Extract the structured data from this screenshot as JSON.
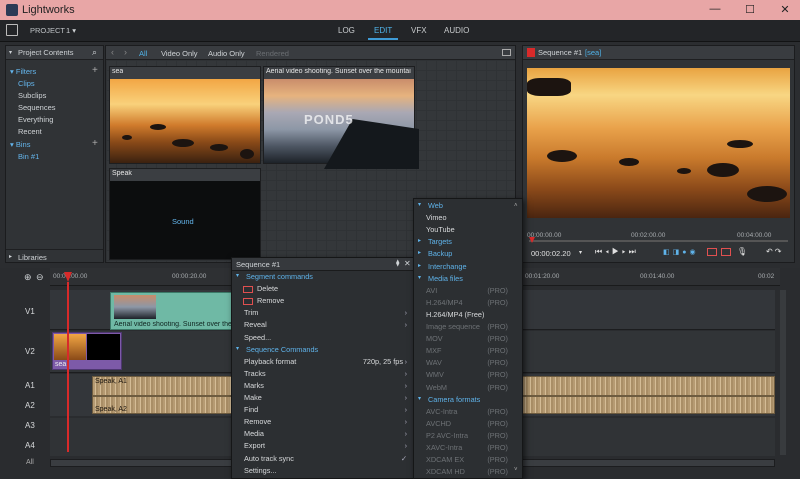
{
  "app": {
    "title": "Lightworks",
    "window": {
      "min": "—",
      "max": "☐",
      "close": "✕"
    }
  },
  "topbar": {
    "project_label": "PROJECT",
    "project_num": "1",
    "tabs": [
      "LOG",
      "EDIT",
      "VFX",
      "AUDIO"
    ],
    "active_tab": "EDIT"
  },
  "sidebar": {
    "title": "Project Contents",
    "filters_label": "Filters",
    "items": [
      "Clips",
      "Subclips",
      "Sequences",
      "Everything",
      "Recent"
    ],
    "bins_label": "Bins",
    "bin_items": [
      "Bin #1"
    ],
    "libraries": "Libraries"
  },
  "browser": {
    "filters": [
      "All",
      "Video Only",
      "Audio Only",
      "Rendered"
    ],
    "clips": [
      {
        "label": "sea",
        "bg": "sunset"
      },
      {
        "label": "Aerial video shooting. Sunset over the mountai",
        "bg": "aerial",
        "watermark": "POND5"
      },
      {
        "label": "Speak",
        "bg": "sound",
        "inner": "Sound"
      }
    ]
  },
  "viewer": {
    "title": "Sequence #1",
    "tag": "[sea]",
    "timecodes": [
      "00:00:00.00",
      "00:02:00.00",
      "00:04:00.00"
    ],
    "current": "00:00:02.20"
  },
  "timeline": {
    "ruler": [
      "00:00:00.00",
      "00:00:20.00",
      "00:01:20.00",
      "00:01:40.00",
      "00:02"
    ],
    "tracks": [
      "V1",
      "V2",
      "A1",
      "A2",
      "A3",
      "A4"
    ],
    "clips": {
      "v1": "Aerial video shooting. Sunset over the",
      "v2": "sea",
      "a1": "Speak, A1",
      "a2": "Speak, A2"
    },
    "all_label": "All"
  },
  "context_menu": {
    "title": "Sequence #1",
    "items": [
      {
        "t": "Segment commands",
        "k": "sec"
      },
      {
        "t": "Delete",
        "k": "icon"
      },
      {
        "t": "Remove",
        "k": "icon"
      },
      {
        "t": "Trim",
        "k": "sub"
      },
      {
        "t": "Reveal",
        "k": "sub"
      },
      {
        "t": "Speed...",
        "k": "item"
      },
      {
        "t": "Sequence Commands",
        "k": "sec"
      },
      {
        "t": "Playback format",
        "k": "item",
        "r": "720p, 25 fps"
      },
      {
        "t": "Tracks",
        "k": "sub"
      },
      {
        "t": "Marks",
        "k": "sub"
      },
      {
        "t": "Make",
        "k": "sub"
      },
      {
        "t": "Find",
        "k": "sub"
      },
      {
        "t": "Remove",
        "k": "sub"
      },
      {
        "t": "Media",
        "k": "sub"
      },
      {
        "t": "Export",
        "k": "sub"
      },
      {
        "t": "Auto track sync",
        "k": "check"
      },
      {
        "t": "Settings...",
        "k": "item"
      }
    ]
  },
  "export_menu": {
    "items": [
      {
        "t": "Web",
        "k": "sec"
      },
      {
        "t": "Vimeo",
        "k": "item"
      },
      {
        "t": "YouTube",
        "k": "item"
      },
      {
        "t": "Targets",
        "k": "sec"
      },
      {
        "t": "Backup",
        "k": "sec"
      },
      {
        "t": "Interchange",
        "k": "sec"
      },
      {
        "t": "Media files",
        "k": "sec"
      },
      {
        "t": "AVI",
        "k": "dis",
        "r": "(PRO)"
      },
      {
        "t": "H.264/MP4",
        "k": "dis",
        "r": "(PRO)"
      },
      {
        "t": "H.264/MP4 (Free)",
        "k": "item"
      },
      {
        "t": "Image sequence",
        "k": "dis",
        "r": "(PRO)"
      },
      {
        "t": "MOV",
        "k": "dis",
        "r": "(PRO)"
      },
      {
        "t": "MXF",
        "k": "dis",
        "r": "(PRO)"
      },
      {
        "t": "WAV",
        "k": "dis",
        "r": "(PRO)"
      },
      {
        "t": "WMV",
        "k": "dis",
        "r": "(PRO)"
      },
      {
        "t": "WebM",
        "k": "dis",
        "r": "(PRO)"
      },
      {
        "t": "Camera formats",
        "k": "sec"
      },
      {
        "t": "AVC-Intra",
        "k": "dis",
        "r": "(PRO)"
      },
      {
        "t": "AVCHD",
        "k": "dis",
        "r": "(PRO)"
      },
      {
        "t": "P2 AVC-Intra",
        "k": "dis",
        "r": "(PRO)"
      },
      {
        "t": "XAVC-Intra",
        "k": "dis",
        "r": "(PRO)"
      },
      {
        "t": "XDCAM EX",
        "k": "dis",
        "r": "(PRO)"
      },
      {
        "t": "XDCAM HD",
        "k": "dis",
        "r": "(PRO)"
      }
    ]
  },
  "colors": {
    "accent": "#3f9bd5",
    "titlebar": "#e8a6a6",
    "playhead": "#d82a2a",
    "v1clip": "#6fb9a5",
    "v2clip": "#7d5aa8",
    "audio": "#c6a880"
  }
}
